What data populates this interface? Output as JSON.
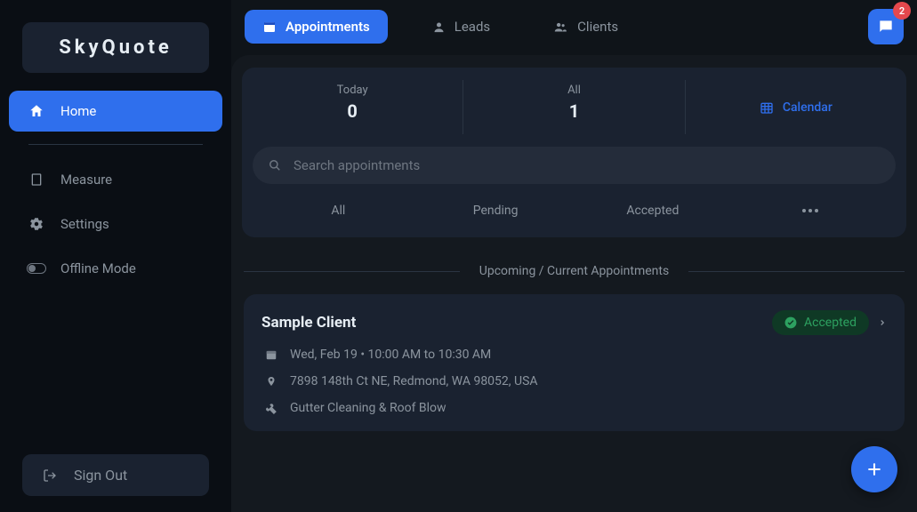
{
  "brand": "SkyQuote",
  "sidebar": {
    "items": [
      {
        "label": "Home"
      },
      {
        "label": "Measure"
      },
      {
        "label": "Settings"
      },
      {
        "label": "Offline Mode"
      }
    ],
    "sign_out": "Sign Out"
  },
  "topTabs": {
    "appointments": "Appointments",
    "leads": "Leads",
    "clients": "Clients"
  },
  "notif_count": "2",
  "stats": {
    "today_label": "Today",
    "today_value": "0",
    "all_label": "All",
    "all_value": "1",
    "calendar_label": "Calendar"
  },
  "search_placeholder": "Search appointments",
  "filters": {
    "all": "All",
    "pending": "Pending",
    "accepted": "Accepted"
  },
  "section_title": "Upcoming / Current Appointments",
  "appointment": {
    "client": "Sample Client",
    "status": "Accepted",
    "datetime": "Wed, Feb 19 • 10:00 AM to 10:30 AM",
    "address": "7898 148th Ct NE, Redmond, WA 98052, USA",
    "service": "Gutter Cleaning & Roof Blow"
  },
  "colors": {
    "accent": "#2f6fed",
    "success": "#2da160",
    "danger": "#e5484d"
  }
}
